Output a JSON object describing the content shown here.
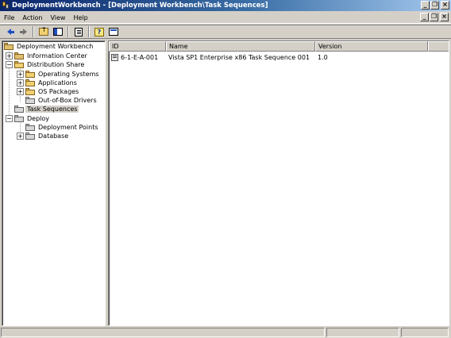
{
  "window": {
    "title": "DeploymentWorkbench - [Deployment Workbench\\Task Sequences]"
  },
  "menu": [
    "File",
    "Action",
    "View",
    "Help"
  ],
  "toolbar": {
    "buttons": [
      "back-icon",
      "forward-icon",
      "up-folder-icon",
      "show-hide-tree-icon",
      "export-list-icon",
      "help-icon",
      "properties-icon"
    ]
  },
  "tree": {
    "root": "Deployment Workbench",
    "information_center": "Information Center",
    "distribution_share": "Distribution Share",
    "operating_systems": "Operating Systems",
    "applications": "Applications",
    "os_packages": "OS Packages",
    "out_of_box_drivers": "Out-of-Box Drivers",
    "task_sequences": "Task Sequences",
    "deploy": "Deploy",
    "deployment_points": "Deployment Points",
    "database": "Database"
  },
  "list": {
    "columns": [
      "ID",
      "Name",
      "Version"
    ],
    "rows": [
      {
        "id": "6-1-E-A-001",
        "name": "Vista SP1 Enterprise x86 Task Sequence 001",
        "version": "1.0"
      }
    ]
  }
}
